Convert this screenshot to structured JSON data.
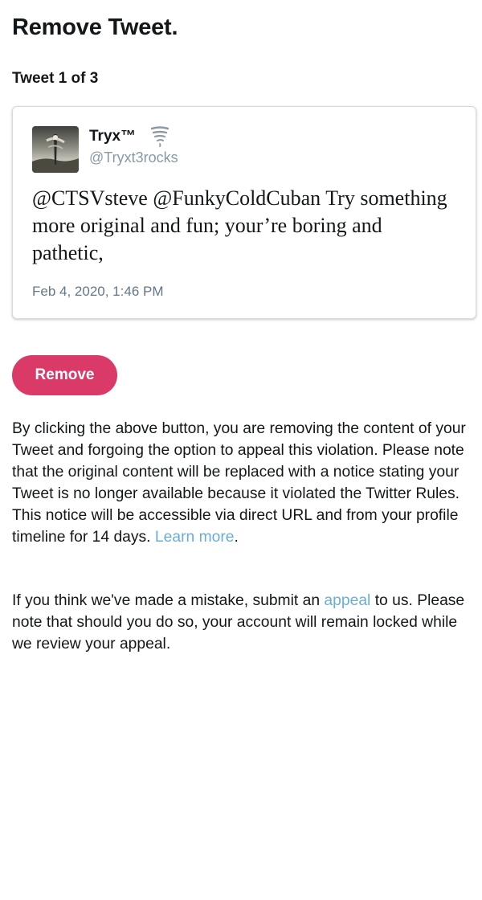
{
  "page": {
    "title": "Remove Tweet.",
    "counter": "Tweet 1 of 3"
  },
  "tweet": {
    "display_name": "Tryx™",
    "badge_icon": "tornado-emoji",
    "handle": "@Tryxt3rocks",
    "text": "@CTSVsteve @FunkyColdCuban Try something more original and fun; your’re boring and pathetic,",
    "timestamp": "Feb 4, 2020, 1:46 PM"
  },
  "actions": {
    "remove_label": "Remove"
  },
  "notice": {
    "paragraph1_text": "By clicking the above button, you are removing the content of your Tweet and forgoing the option to appeal this violation. Please note that the original content will be replaced with a notice stating your Tweet is no longer available because it violated the Twitter Rules. This notice will be accessible via direct URL and from your profile timeline for 14 days.",
    "learn_more_label": "Learn more",
    "paragraph1_end": ".",
    "paragraph2_before": "If you think we've made a mistake, submit an",
    "appeal_label": "appeal",
    "paragraph2_after": "to us. Please note that should you do so, your account will remain locked while we review your appeal."
  },
  "colors": {
    "accent_button": "#d93a67",
    "link": "#6aaed6",
    "text": "#14171a",
    "muted": "#657786"
  }
}
